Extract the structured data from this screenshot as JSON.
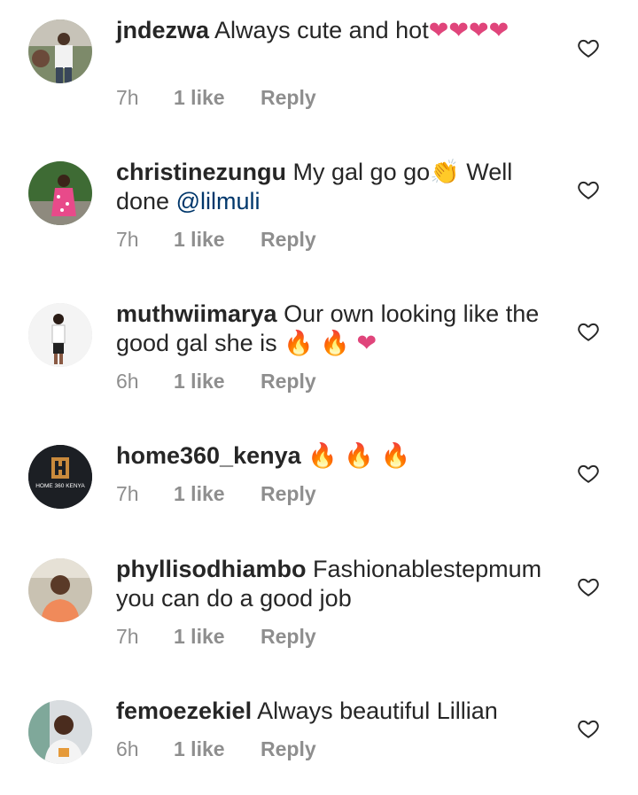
{
  "comments": [
    {
      "username": "jndezwa",
      "text": "Always cute and hot",
      "emojis": [
        "❤",
        "❤",
        "❤",
        "❤"
      ],
      "time": "7h",
      "likes": "1 like",
      "reply": "Reply"
    },
    {
      "username": "christinezungu",
      "text": "My gal go go",
      "emojis_inline": [
        "👏"
      ],
      "text_after": "Well done",
      "mention": "@lilmuli",
      "time": "7h",
      "likes": "1 like",
      "reply": "Reply"
    },
    {
      "username": "muthwiimarya",
      "text": "Our own looking like the good gal she is",
      "emojis": [
        "🔥",
        "🔥",
        "❤"
      ],
      "time": "6h",
      "likes": "1 like",
      "reply": "Reply"
    },
    {
      "username": "home360_kenya",
      "text": "",
      "emojis": [
        "🔥",
        "🔥",
        "🔥"
      ],
      "avatar_text": "HOME 360 KENYA",
      "time": "7h",
      "likes": "1 like",
      "reply": "Reply"
    },
    {
      "username": "phyllisodhiambo",
      "text": "Fashionablestepmum you can do a good job",
      "time": "7h",
      "likes": "1 like",
      "reply": "Reply"
    },
    {
      "username": "femoezekiel",
      "text": "Always beautiful Lillian",
      "time": "6h",
      "likes": "1 like",
      "reply": "Reply"
    }
  ],
  "colors": {
    "text": "#262626",
    "meta": "#8e8e8e",
    "mention": "#00376b",
    "heart_emoji": "#e0457b",
    "fire_emoji": "#f36b16"
  }
}
